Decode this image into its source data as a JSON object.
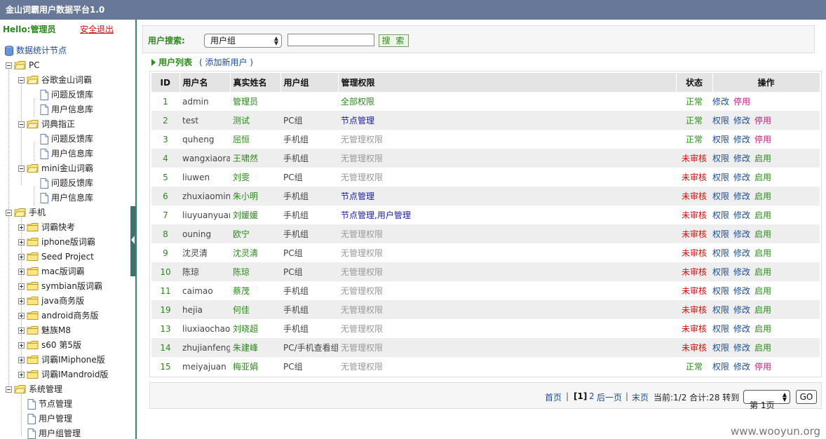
{
  "window": {
    "title": "金山词霸用户数据平台1.0"
  },
  "sidebar": {
    "hello": "Hello:管理员",
    "logout": "安全退出",
    "tree": [
      {
        "label": "数据统计节点",
        "type": "db"
      },
      {
        "label": "PC",
        "type": "folder-open"
      },
      {
        "label": "谷歌金山词霸",
        "type": "folder-open"
      },
      {
        "label": "问题反馈库",
        "type": "page"
      },
      {
        "label": "用户信息库",
        "type": "page"
      },
      {
        "label": "词典指正",
        "type": "folder-open"
      },
      {
        "label": "问题反馈库",
        "type": "page"
      },
      {
        "label": "用户信息库",
        "type": "page"
      },
      {
        "label": "mini金山词霸",
        "type": "folder-open"
      },
      {
        "label": "问题反馈库",
        "type": "page"
      },
      {
        "label": "用户信息库",
        "type": "page"
      },
      {
        "label": "手机",
        "type": "folder-open"
      },
      {
        "label": "词霸快考",
        "type": "folder"
      },
      {
        "label": "iphone版词霸",
        "type": "folder"
      },
      {
        "label": "Seed Project",
        "type": "folder"
      },
      {
        "label": "mac版词霸",
        "type": "folder"
      },
      {
        "label": "symbian版词霸",
        "type": "folder"
      },
      {
        "label": "java商务版",
        "type": "folder"
      },
      {
        "label": "android商务版",
        "type": "folder"
      },
      {
        "label": "魅族M8",
        "type": "folder"
      },
      {
        "label": "s60 第5版",
        "type": "folder"
      },
      {
        "label": "词霸IMiphone版",
        "type": "folder"
      },
      {
        "label": "词霸IMandroid版",
        "type": "folder"
      },
      {
        "label": "系统管理",
        "type": "folder-open"
      },
      {
        "label": "节点管理",
        "type": "page"
      },
      {
        "label": "用户管理",
        "type": "page"
      },
      {
        "label": "用户组管理",
        "type": "page"
      }
    ]
  },
  "search": {
    "label": "用户搜索:",
    "select_value": "用户组",
    "input_value": "",
    "button": "搜 索"
  },
  "list": {
    "title": "用户列表",
    "add_link": "( 添加新用户 )"
  },
  "table": {
    "headers": [
      "ID",
      "用户名",
      "真实姓名",
      "用户组",
      "管理权限",
      "状态",
      "操作"
    ],
    "rows": [
      {
        "id": "1",
        "user": "admin",
        "real": "管理员",
        "group": "",
        "perm": "全部权限",
        "perm_kind": "all",
        "status": "正常",
        "status_kind": "ok",
        "ops": [
          "修改",
          "停用"
        ]
      },
      {
        "id": "2",
        "user": "test",
        "real": "测试",
        "group": "PC组",
        "perm": "节点管理",
        "perm_kind": "node",
        "status": "正常",
        "status_kind": "ok",
        "ops": [
          "权限",
          "修改",
          "停用"
        ]
      },
      {
        "id": "3",
        "user": "quheng",
        "real": "屈恒",
        "group": "手机组",
        "perm": "无管理权限",
        "perm_kind": "none",
        "status": "正常",
        "status_kind": "ok",
        "ops": [
          "权限",
          "修改",
          "停用"
        ]
      },
      {
        "id": "4",
        "user": "wangxiaoran",
        "real": "王啸然",
        "group": "手机组",
        "perm": "无管理权限",
        "perm_kind": "none",
        "status": "未审核",
        "status_kind": "pending",
        "ops": [
          "权限",
          "修改",
          "启用"
        ]
      },
      {
        "id": "5",
        "user": "liuwen",
        "real": "刘雯",
        "group": "PC组",
        "perm": "无管理权限",
        "perm_kind": "none",
        "status": "未审核",
        "status_kind": "pending",
        "ops": [
          "权限",
          "修改",
          "启用"
        ]
      },
      {
        "id": "6",
        "user": "zhuxiaoming",
        "real": "朱小明",
        "group": "手机组",
        "perm": "节点管理",
        "perm_kind": "node",
        "status": "未审核",
        "status_kind": "pending",
        "ops": [
          "权限",
          "修改",
          "启用"
        ]
      },
      {
        "id": "7",
        "user": "liuyuanyuan",
        "real": "刘媛媛",
        "group": "手机组",
        "perm": "节点管理,用户管理",
        "perm_kind": "node",
        "status": "未审核",
        "status_kind": "pending",
        "ops": [
          "权限",
          "修改",
          "启用"
        ]
      },
      {
        "id": "8",
        "user": "ouning",
        "real": "欧宁",
        "group": "手机组",
        "perm": "无管理权限",
        "perm_kind": "none",
        "status": "未审核",
        "status_kind": "pending",
        "ops": [
          "权限",
          "修改",
          "启用"
        ]
      },
      {
        "id": "9",
        "user": "沈灵清",
        "real": "沈灵清",
        "group": "PC组",
        "perm": "无管理权限",
        "perm_kind": "none",
        "status": "未审核",
        "status_kind": "pending",
        "ops": [
          "权限",
          "修改",
          "启用"
        ]
      },
      {
        "id": "10",
        "user": "陈琼",
        "real": "陈琼",
        "group": "PC组",
        "perm": "无管理权限",
        "perm_kind": "none",
        "status": "未审核",
        "status_kind": "pending",
        "ops": [
          "权限",
          "修改",
          "启用"
        ]
      },
      {
        "id": "11",
        "user": "caimao",
        "real": "蔡茂",
        "group": "手机组",
        "perm": "无管理权限",
        "perm_kind": "none",
        "status": "未审核",
        "status_kind": "pending",
        "ops": [
          "权限",
          "修改",
          "启用"
        ]
      },
      {
        "id": "19",
        "user": "hejia",
        "real": "何佳",
        "group": "手机组",
        "perm": "无管理权限",
        "perm_kind": "none",
        "status": "未审核",
        "status_kind": "pending",
        "ops": [
          "权限",
          "修改",
          "启用"
        ]
      },
      {
        "id": "13",
        "user": "liuxiaochao",
        "real": "刘晓超",
        "group": "手机组",
        "perm": "无管理权限",
        "perm_kind": "none",
        "status": "未审核",
        "status_kind": "pending",
        "ops": [
          "权限",
          "修改",
          "启用"
        ]
      },
      {
        "id": "14",
        "user": "zhujianfeng",
        "real": "朱建峰",
        "group": "PC/手机查看组",
        "perm": "无管理权限",
        "perm_kind": "none",
        "status": "未审核",
        "status_kind": "pending",
        "ops": [
          "权限",
          "修改",
          "启用"
        ]
      },
      {
        "id": "15",
        "user": "meiyajuan",
        "real": "梅亚娟",
        "group": "PC组",
        "perm": "无管理权限",
        "perm_kind": "none",
        "status": "正常",
        "status_kind": "ok",
        "ops": [
          "权限",
          "修改",
          "停用"
        ]
      }
    ]
  },
  "pager": {
    "first": "首页",
    "sep": "|",
    "current_page": "[1]",
    "page2": "2",
    "next": "后一页",
    "last": "末页",
    "info": "当前:1/2 合计:28 转到",
    "page_select": "第 1页",
    "go": "GO"
  },
  "watermark": "www.wooyun.org",
  "colors": {
    "titlebar": "#687898",
    "green": "#2a8a1a",
    "red": "#d01010",
    "link": "#1a4c9a",
    "stop": "#c0207a"
  }
}
